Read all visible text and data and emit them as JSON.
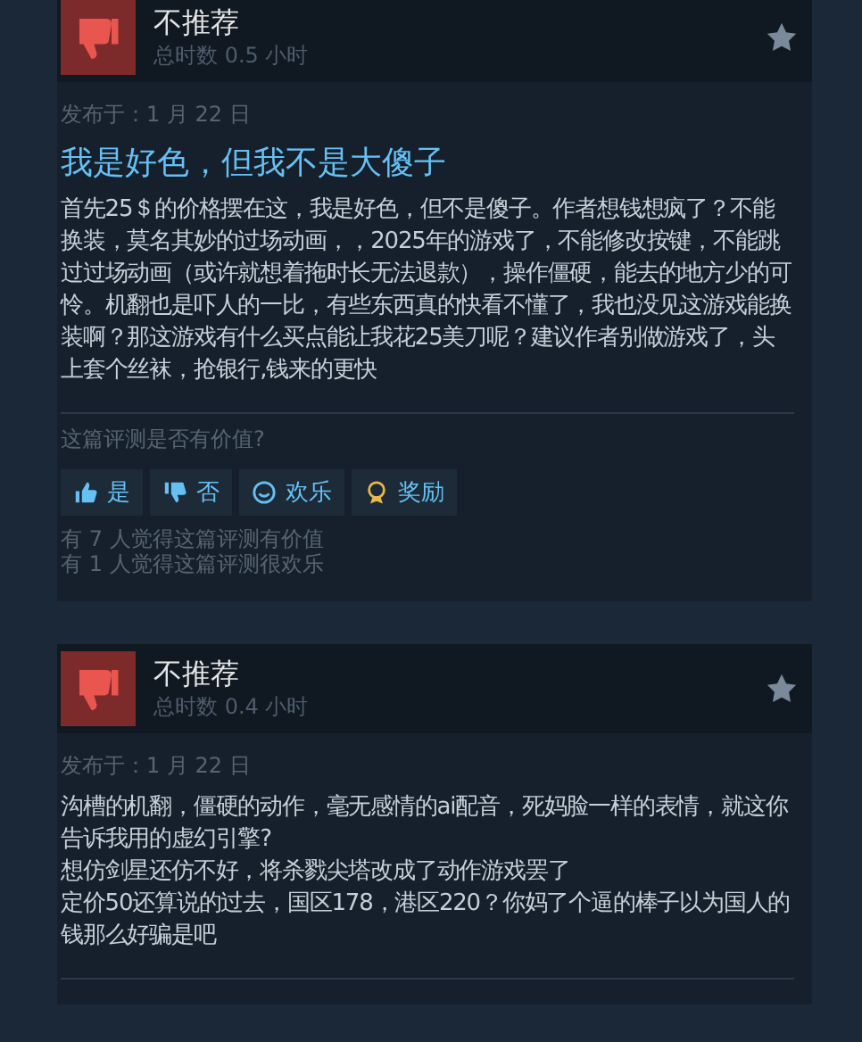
{
  "reviews": [
    {
      "recommended": false,
      "rating": "不推荐",
      "hours": "总时数 0.5 小时",
      "posted": "发布于：1 月 22 日",
      "title": "我是好色，但我不是大傻子",
      "body": [
        "首先25＄的价格摆在这，我是好色，但不是傻子。作者想钱想疯了？不能换装，莫名其妙的过场动画，，2025年的游戏了，不能修改按键，不能跳过过场动画（或许就想着拖时长无法退款），操作僵硬，能去的地方少的可怜。机翻也是吓人的一比，有些东西真的快看不懂了，我也没见这游戏能换装啊？那这游戏有什么买点能让我花25美刀呢？建议作者别做游戏了，头上套个丝袜，抢银行,钱来的更快"
      ],
      "question": "这篇评测是否有价值?",
      "votes": [
        {
          "kind": "yes",
          "label": "是"
        },
        {
          "kind": "no",
          "label": "否"
        },
        {
          "kind": "funny",
          "label": "欢乐"
        },
        {
          "kind": "award",
          "label": "奖励"
        }
      ],
      "stats": [
        "有 7 人觉得这篇评测有价值",
        "有 1 人觉得这篇评测很欢乐"
      ]
    },
    {
      "recommended": false,
      "rating": "不推荐",
      "hours": "总时数 0.4 小时",
      "posted": "发布于：1 月 22 日",
      "body": [
        "沟槽的机翻，僵硬的动作，毫无感情的ai配音，死妈脸一样的表情，就这你告诉我用的虚幻引擎?",
        "想仿剑星还仿不好，将杀戮尖塔改成了动作游戏罢了",
        "定价50还算说的过去，国区178，港区220？你妈了个逼的棒子以为国人的钱那么好骗是吧"
      ]
    }
  ]
}
